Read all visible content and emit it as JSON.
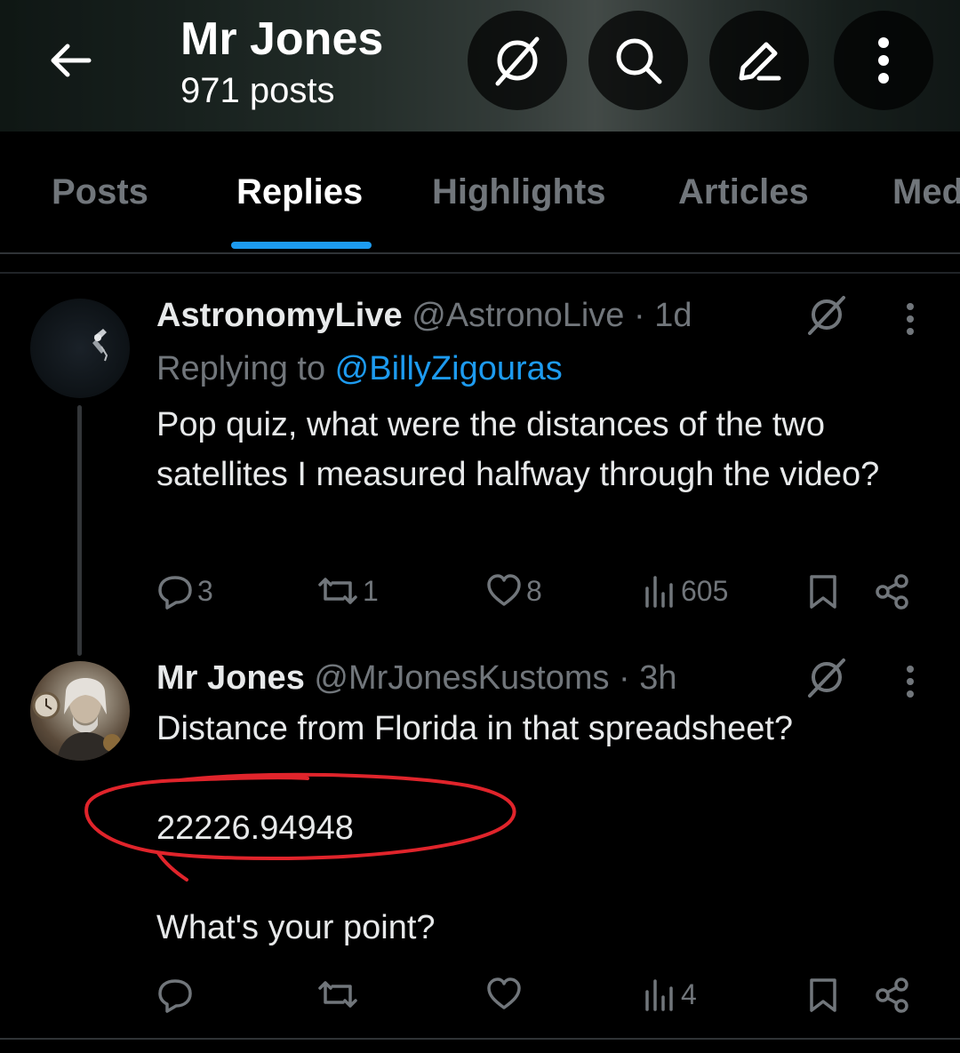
{
  "header": {
    "title": "Mr Jones",
    "subtitle": "971 posts",
    "icons": [
      "back-arrow-icon",
      "grok-icon",
      "search-icon",
      "edit-icon",
      "more-vertical-icon"
    ]
  },
  "tabs": [
    {
      "label": "Posts",
      "active": false
    },
    {
      "label": "Replies",
      "active": true
    },
    {
      "label": "Highlights",
      "active": false
    },
    {
      "label": "Articles",
      "active": false
    },
    {
      "label": "Med",
      "active": false
    }
  ],
  "posts": [
    {
      "name": "AstronomyLive",
      "meta": "@AstronoLive · 1d",
      "replying_label": "Replying to ",
      "replying_handle": "@BillyZigouras",
      "text": "Pop quiz, what were the distances of the two satellites I measured halfway through the video?",
      "replies": "3",
      "reposts": "1",
      "likes": "8",
      "views": "605"
    },
    {
      "name": "Mr Jones",
      "meta": "@MrJonesKustoms · 3h",
      "text_line1": "Distance from Florida in that spreadsheet?",
      "highlight_value": "22226.94948",
      "text_line2": "What's your point?",
      "views": "4"
    }
  ],
  "colors": {
    "accent": "#1d9bf0",
    "muted": "#71767b",
    "annotation": "#e0242b"
  }
}
